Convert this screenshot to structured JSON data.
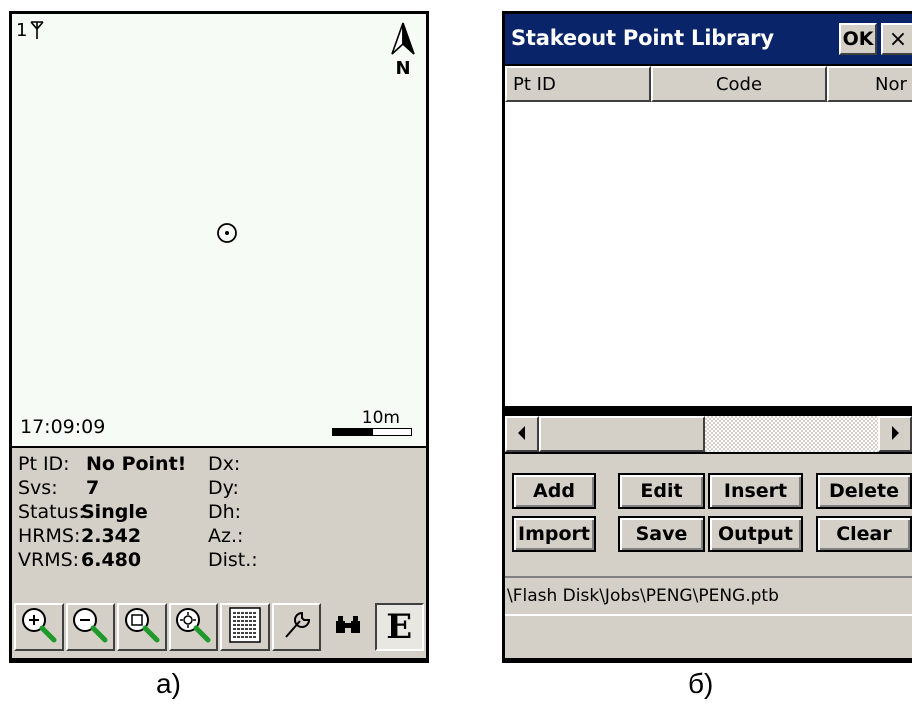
{
  "screen_a": {
    "caption": "а)",
    "map": {
      "satellite_count": "1",
      "north_label": "N",
      "time": "17:09:09",
      "scale_label": "10m"
    },
    "info": {
      "pt_id_label": "Pt ID:",
      "pt_id_value": "No Point!",
      "svs_label": "Svs:",
      "svs_value": "7",
      "status_label": "Status:",
      "status_value": "Single",
      "hrms_label": "HRMS:",
      "hrms_value": "2.342",
      "vrms_label": "VRMS:",
      "vrms_value": "6.480",
      "dx_label": "Dx:",
      "dy_label": "Dy:",
      "dh_label": "Dh:",
      "az_label": "Az.:",
      "dist_label": "Dist.:"
    },
    "toolbar": {
      "icons": [
        "zoom-in-icon",
        "zoom-out-icon",
        "zoom-extents-icon",
        "zoom-center-icon",
        "list-icon",
        "settings-icon",
        "binoculars-icon",
        "edit-mode-icon"
      ],
      "edit_mode_letter": "E"
    }
  },
  "screen_b": {
    "caption": "б)",
    "title": "Stakeout Point Library",
    "ok_label": "OK",
    "close_label": "×",
    "columns": [
      "Pt ID",
      "Code",
      "Nor"
    ],
    "buttons": {
      "add": "Add",
      "edit": "Edit",
      "insert": "Insert",
      "delete": "Delete",
      "import": "Import",
      "save": "Save",
      "output": "Output",
      "clear": "Clear"
    },
    "file_path": "\\Flash Disk\\Jobs\\PENG\\PENG.ptb"
  }
}
